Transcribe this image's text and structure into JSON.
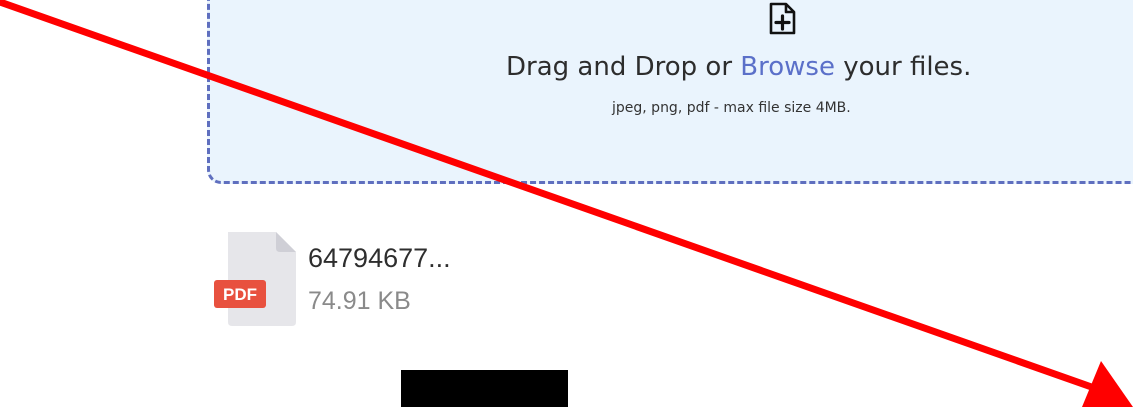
{
  "dropzone": {
    "prefix": "Drag and Drop or ",
    "browse_label": "Browse",
    "suffix": " your files.",
    "hint": "jpeg, png, pdf - max file size 4MB.",
    "icon": "file-plus-icon"
  },
  "file": {
    "name": "64794677...",
    "size": "74.91 KB",
    "type_badge": "PDF",
    "icon": "pdf-file-icon"
  },
  "annotation": {
    "icon": "red-arrow-annotation",
    "color": "#ff0000"
  },
  "colors": {
    "dropzone_bg": "#eaf4fd",
    "dropzone_border": "#5f6fbf",
    "link": "#5b70c9",
    "pdf_badge": "#e8513f"
  }
}
